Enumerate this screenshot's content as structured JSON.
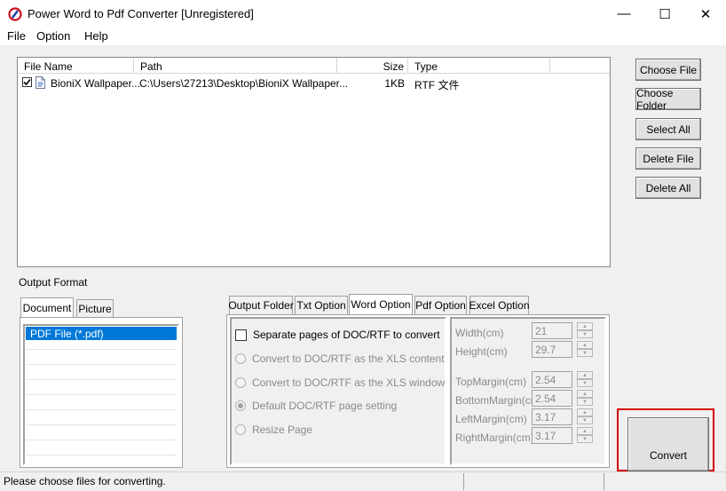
{
  "window": {
    "title": "Power Word to Pdf Converter [Unregistered]",
    "minimize": "—",
    "maximize": "☐",
    "close": "✕"
  },
  "menu": {
    "file": "File",
    "option": "Option",
    "help": "Help"
  },
  "list": {
    "columns": {
      "name": "File Name",
      "path": "Path",
      "size": "Size",
      "type": "Type"
    },
    "rows": [
      {
        "checked": true,
        "name": "BioniX Wallpaper...",
        "path": "C:\\Users\\27213\\Desktop\\BioniX Wallpaper...",
        "size": "1KB",
        "type": "RTF 文件"
      }
    ]
  },
  "buttons": {
    "choose_file": "Choose File",
    "choose_folder": "Choose Folder",
    "select_all": "Select All",
    "delete_file": "Delete File",
    "delete_all": "Delete All",
    "convert": "Convert"
  },
  "output_format": {
    "label": "Output Format",
    "tabs": {
      "document": "Document",
      "picture": "Picture"
    },
    "selected": "PDF File  (*.pdf)"
  },
  "option_tabs": {
    "output_folder": "Output Folder",
    "txt": "Txt Option",
    "word": "Word Option",
    "pdf": "Pdf Option",
    "excel": "Excel Option"
  },
  "word_option": {
    "separate_pages": "Separate pages of DOC/RTF to convert",
    "radio_xls_content": "Convert to DOC/RTF as the XLS content",
    "radio_xls_window": "Convert to DOC/RTF as the XLS window",
    "radio_default": "Default DOC/RTF page setting",
    "radio_resize": "Resize Page"
  },
  "page_settings": {
    "width_label": "Width(cm)",
    "width": "21",
    "height_label": "Height(cm)",
    "height": "29.7",
    "top_label": "TopMargin(cm)",
    "top": "2.54",
    "bottom_label": "BottomMargin(cm)",
    "bottom": "2.54",
    "left_label": "LeftMargin(cm)",
    "left": "3.17",
    "right_label": "RightMargin(cm)",
    "right": "3.17"
  },
  "status": {
    "text": "Please choose files for converting."
  },
  "colors": {
    "accent_red": "#d40000",
    "selection_blue": "#0078d7"
  }
}
